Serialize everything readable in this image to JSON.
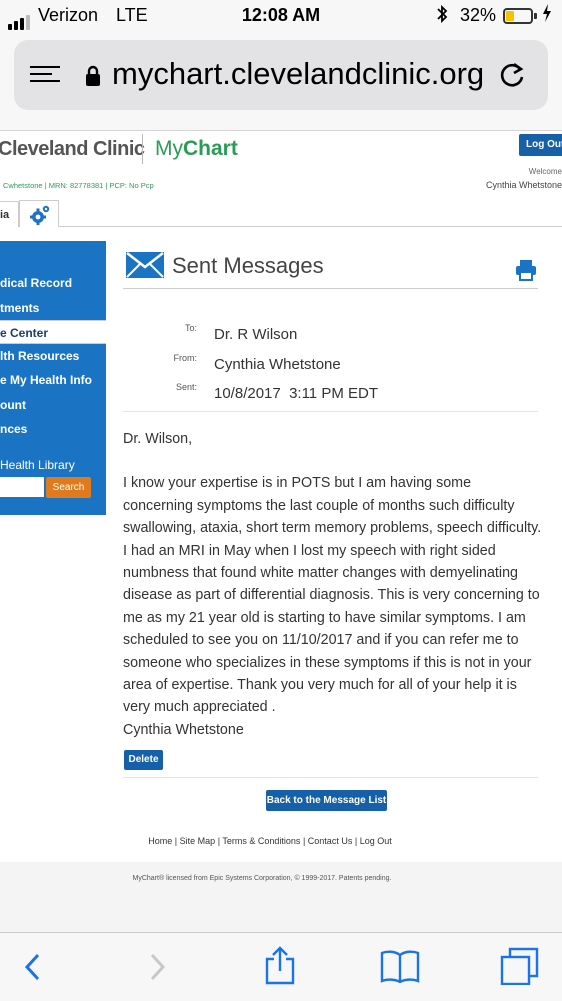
{
  "status_bar": {
    "carrier": "Verizon",
    "network": "LTE",
    "time": "12:08 AM",
    "battery_percent": "32%",
    "battery_level": 0.32,
    "icons": [
      "signal-icon",
      "bluetooth-icon",
      "battery-icon",
      "charging-icon"
    ]
  },
  "browser": {
    "url": "mychart.clevelandclinic.org",
    "icons": [
      "reader-icon",
      "lock-icon",
      "reload-icon"
    ]
  },
  "header": {
    "brand_name": "Cleveland Clinic",
    "product_prefix": "My",
    "product_suffix": "Chart",
    "logout_label": "Log Out",
    "welcome_label": "Welcome",
    "welcome_name": "Cynthia Whetstone",
    "patient_info": "Cwhetstone | MRN: 82778381 | PCP: No Pcp"
  },
  "tabs": {
    "patient_tab": "ia",
    "settings_icon": "gear-icon"
  },
  "sidebar": {
    "items": [
      {
        "label": "dical Record",
        "active": false
      },
      {
        "label": "tments",
        "active": false
      },
      {
        "label": "e Center",
        "active": true
      },
      {
        "label": "lth Resources",
        "active": false
      },
      {
        "label": "e My Health Info",
        "active": false
      },
      {
        "label": "ount",
        "active": false
      },
      {
        "label": "nces",
        "active": false
      }
    ],
    "library_label": "Health Library",
    "search_button": "Search"
  },
  "message": {
    "page_title": "Sent Messages",
    "to_label": "To:",
    "to_value": "Dr. R Wilson",
    "from_label": "From:",
    "from_value": "Cynthia Whetstone",
    "sent_label": "Sent:",
    "sent_value": "10/8/2017  3:11 PM EDT",
    "greeting": "Dr. Wilson,",
    "body": "I know your expertise is in POTS but I am having some concerning symptoms the last couple of months such difficulty swallowing, ataxia, short term memory problems, speech difficulty. I had an MRI in May when I lost my speech with right sided numbness that found white matter changes with demyelinating disease as part of differential diagnosis. This is very concerning to me as my 21 year old is starting to have similar symptoms. I am scheduled to see you on 11/10/2017 and if you can refer me to someone who specializes in these symptoms if this is not in your area of expertise. Thank you very much for all of your help it is very much appreciated .",
    "signature": "Cynthia Whetstone",
    "delete_label": "Delete",
    "back_label": "Back to the Message List"
  },
  "footer": {
    "links": [
      "Home",
      "Site Map",
      "Terms & Conditions",
      "Contact Us",
      "Log Out"
    ],
    "separator": "|",
    "copyright": "MyChart® licensed from Epic Systems Corporation, © 1999-2017. Patents pending."
  },
  "toolbar": {
    "icons": [
      "back-icon",
      "forward-icon",
      "share-icon",
      "bookmarks-icon",
      "tabs-icon"
    ]
  }
}
